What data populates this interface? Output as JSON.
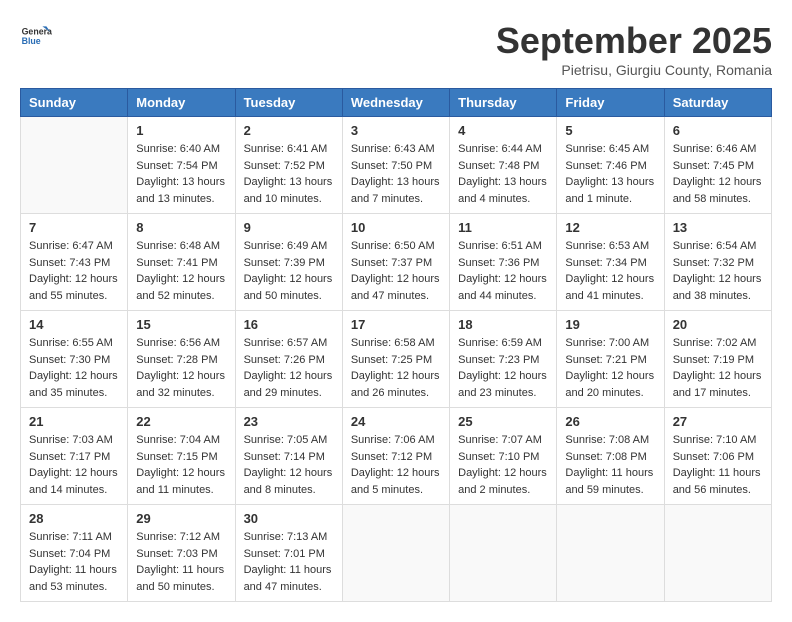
{
  "header": {
    "logo_line1": "General",
    "logo_line2": "Blue",
    "month_title": "September 2025",
    "location": "Pietrisu, Giurgiu County, Romania"
  },
  "days_of_week": [
    "Sunday",
    "Monday",
    "Tuesday",
    "Wednesday",
    "Thursday",
    "Friday",
    "Saturday"
  ],
  "weeks": [
    [
      {
        "day": "",
        "info": ""
      },
      {
        "day": "1",
        "info": "Sunrise: 6:40 AM\nSunset: 7:54 PM\nDaylight: 13 hours\nand 13 minutes."
      },
      {
        "day": "2",
        "info": "Sunrise: 6:41 AM\nSunset: 7:52 PM\nDaylight: 13 hours\nand 10 minutes."
      },
      {
        "day": "3",
        "info": "Sunrise: 6:43 AM\nSunset: 7:50 PM\nDaylight: 13 hours\nand 7 minutes."
      },
      {
        "day": "4",
        "info": "Sunrise: 6:44 AM\nSunset: 7:48 PM\nDaylight: 13 hours\nand 4 minutes."
      },
      {
        "day": "5",
        "info": "Sunrise: 6:45 AM\nSunset: 7:46 PM\nDaylight: 13 hours\nand 1 minute."
      },
      {
        "day": "6",
        "info": "Sunrise: 6:46 AM\nSunset: 7:45 PM\nDaylight: 12 hours\nand 58 minutes."
      }
    ],
    [
      {
        "day": "7",
        "info": "Sunrise: 6:47 AM\nSunset: 7:43 PM\nDaylight: 12 hours\nand 55 minutes."
      },
      {
        "day": "8",
        "info": "Sunrise: 6:48 AM\nSunset: 7:41 PM\nDaylight: 12 hours\nand 52 minutes."
      },
      {
        "day": "9",
        "info": "Sunrise: 6:49 AM\nSunset: 7:39 PM\nDaylight: 12 hours\nand 50 minutes."
      },
      {
        "day": "10",
        "info": "Sunrise: 6:50 AM\nSunset: 7:37 PM\nDaylight: 12 hours\nand 47 minutes."
      },
      {
        "day": "11",
        "info": "Sunrise: 6:51 AM\nSunset: 7:36 PM\nDaylight: 12 hours\nand 44 minutes."
      },
      {
        "day": "12",
        "info": "Sunrise: 6:53 AM\nSunset: 7:34 PM\nDaylight: 12 hours\nand 41 minutes."
      },
      {
        "day": "13",
        "info": "Sunrise: 6:54 AM\nSunset: 7:32 PM\nDaylight: 12 hours\nand 38 minutes."
      }
    ],
    [
      {
        "day": "14",
        "info": "Sunrise: 6:55 AM\nSunset: 7:30 PM\nDaylight: 12 hours\nand 35 minutes."
      },
      {
        "day": "15",
        "info": "Sunrise: 6:56 AM\nSunset: 7:28 PM\nDaylight: 12 hours\nand 32 minutes."
      },
      {
        "day": "16",
        "info": "Sunrise: 6:57 AM\nSunset: 7:26 PM\nDaylight: 12 hours\nand 29 minutes."
      },
      {
        "day": "17",
        "info": "Sunrise: 6:58 AM\nSunset: 7:25 PM\nDaylight: 12 hours\nand 26 minutes."
      },
      {
        "day": "18",
        "info": "Sunrise: 6:59 AM\nSunset: 7:23 PM\nDaylight: 12 hours\nand 23 minutes."
      },
      {
        "day": "19",
        "info": "Sunrise: 7:00 AM\nSunset: 7:21 PM\nDaylight: 12 hours\nand 20 minutes."
      },
      {
        "day": "20",
        "info": "Sunrise: 7:02 AM\nSunset: 7:19 PM\nDaylight: 12 hours\nand 17 minutes."
      }
    ],
    [
      {
        "day": "21",
        "info": "Sunrise: 7:03 AM\nSunset: 7:17 PM\nDaylight: 12 hours\nand 14 minutes."
      },
      {
        "day": "22",
        "info": "Sunrise: 7:04 AM\nSunset: 7:15 PM\nDaylight: 12 hours\nand 11 minutes."
      },
      {
        "day": "23",
        "info": "Sunrise: 7:05 AM\nSunset: 7:14 PM\nDaylight: 12 hours\nand 8 minutes."
      },
      {
        "day": "24",
        "info": "Sunrise: 7:06 AM\nSunset: 7:12 PM\nDaylight: 12 hours\nand 5 minutes."
      },
      {
        "day": "25",
        "info": "Sunrise: 7:07 AM\nSunset: 7:10 PM\nDaylight: 12 hours\nand 2 minutes."
      },
      {
        "day": "26",
        "info": "Sunrise: 7:08 AM\nSunset: 7:08 PM\nDaylight: 11 hours\nand 59 minutes."
      },
      {
        "day": "27",
        "info": "Sunrise: 7:10 AM\nSunset: 7:06 PM\nDaylight: 11 hours\nand 56 minutes."
      }
    ],
    [
      {
        "day": "28",
        "info": "Sunrise: 7:11 AM\nSunset: 7:04 PM\nDaylight: 11 hours\nand 53 minutes."
      },
      {
        "day": "29",
        "info": "Sunrise: 7:12 AM\nSunset: 7:03 PM\nDaylight: 11 hours\nand 50 minutes."
      },
      {
        "day": "30",
        "info": "Sunrise: 7:13 AM\nSunset: 7:01 PM\nDaylight: 11 hours\nand 47 minutes."
      },
      {
        "day": "",
        "info": ""
      },
      {
        "day": "",
        "info": ""
      },
      {
        "day": "",
        "info": ""
      },
      {
        "day": "",
        "info": ""
      }
    ]
  ]
}
